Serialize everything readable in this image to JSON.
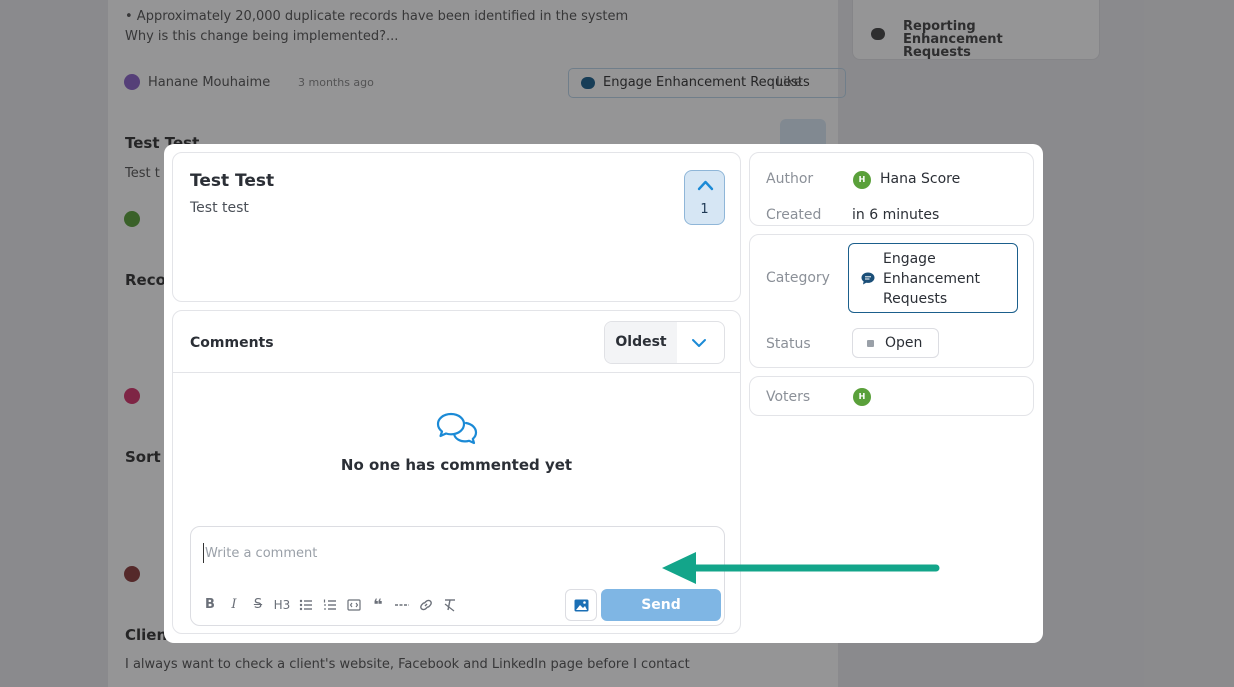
{
  "background": {
    "lines": [
      "• Approximately 20,000 duplicate records have been identified in the system",
      "Why is this change being implemented?..."
    ],
    "author_name": "Hanane Mouhaime",
    "author_time": "3 months ago",
    "category_chip": "Engage Enhancement Requests",
    "like_label": "Like",
    "side_item": "Reporting Enhancement Requests",
    "post_titles": [
      "Test Test",
      "Reco",
      "Sort",
      "Clien"
    ],
    "post_snippets": [
      "Test t",
      "I always want to check a client's website, Facebook and LinkedIn page before I contact"
    ]
  },
  "post": {
    "title": "Test Test",
    "body": "Test test",
    "votes": "1"
  },
  "comments": {
    "title": "Comments",
    "sort_value": "Oldest",
    "empty_message": "No one has commented yet",
    "placeholder": "Write a comment",
    "send_label": "Send",
    "heading_label": "H3"
  },
  "meta": {
    "author_label": "Author",
    "author_name": "Hana Score",
    "author_initial": "H",
    "created_label": "Created",
    "created_value": "in 6 minutes",
    "category_label": "Category",
    "category_value": "Engage Enhancement Requests",
    "status_label": "Status",
    "status_value": "Open",
    "voters_label": "Voters",
    "voter_initial": "H"
  },
  "colors": {
    "accent": "#1b8ad6",
    "send_button": "#7fb6e4",
    "annotation_arrow": "#13a58a",
    "avatar": "#5aa03a"
  }
}
